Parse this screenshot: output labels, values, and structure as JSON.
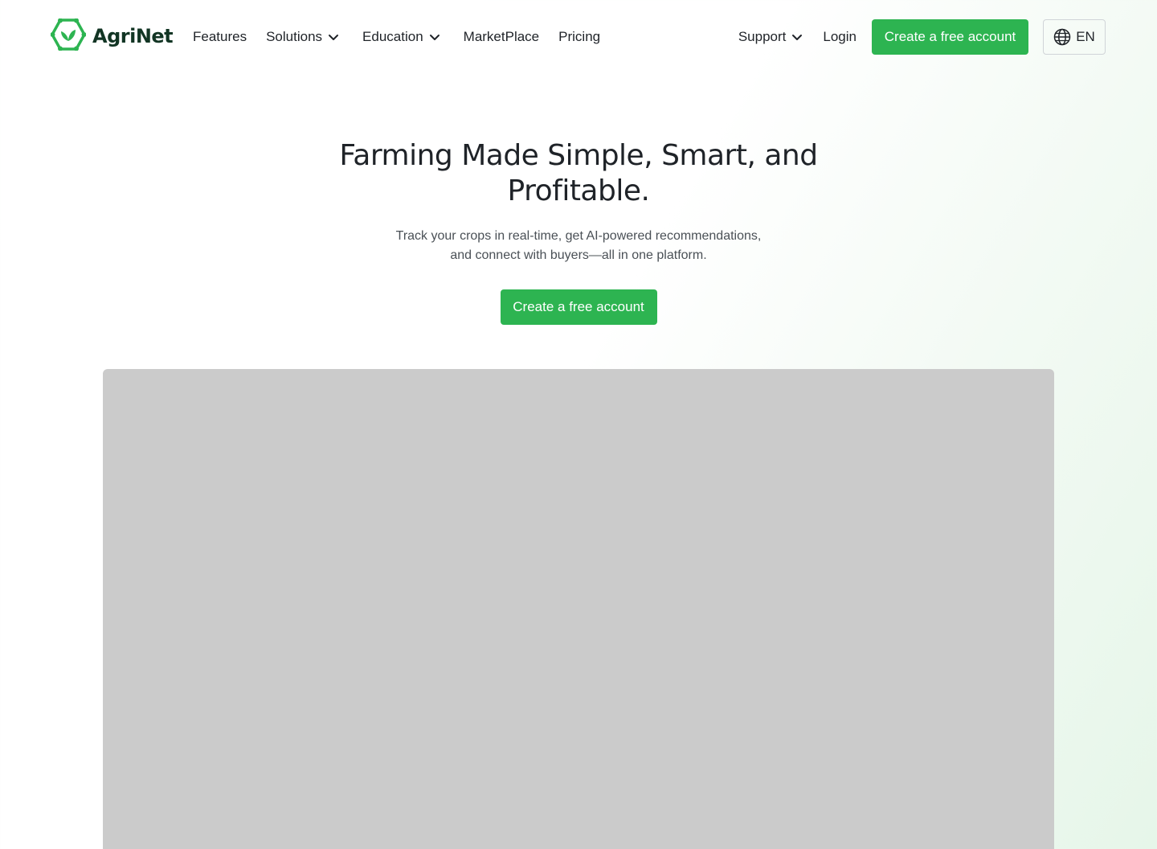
{
  "brand": {
    "name": "AgriNet",
    "logo_icon": "hexagon-leaf-icon",
    "accent_color": "#2db451"
  },
  "nav": {
    "links": [
      {
        "label": "Features",
        "dropdown": false
      },
      {
        "label": "Solutions",
        "dropdown": true
      },
      {
        "label": "Education",
        "dropdown": true
      },
      {
        "label": "MarketPlace",
        "dropdown": false
      },
      {
        "label": "Pricing",
        "dropdown": false
      }
    ],
    "support_label": "Support",
    "login_label": "Login",
    "cta_label": "Create a free account",
    "language": {
      "icon": "globe-icon",
      "code": "EN"
    }
  },
  "hero": {
    "title": "Farming Made Simple, Smart, and Profitable.",
    "subtitle_line1": "Track your crops in real-time, get AI-powered recommendations,",
    "subtitle_line2": "and connect with buyers—all in one platform.",
    "cta_label": "Create a free account"
  },
  "media": {
    "placeholder_color": "#cbcbcb"
  }
}
